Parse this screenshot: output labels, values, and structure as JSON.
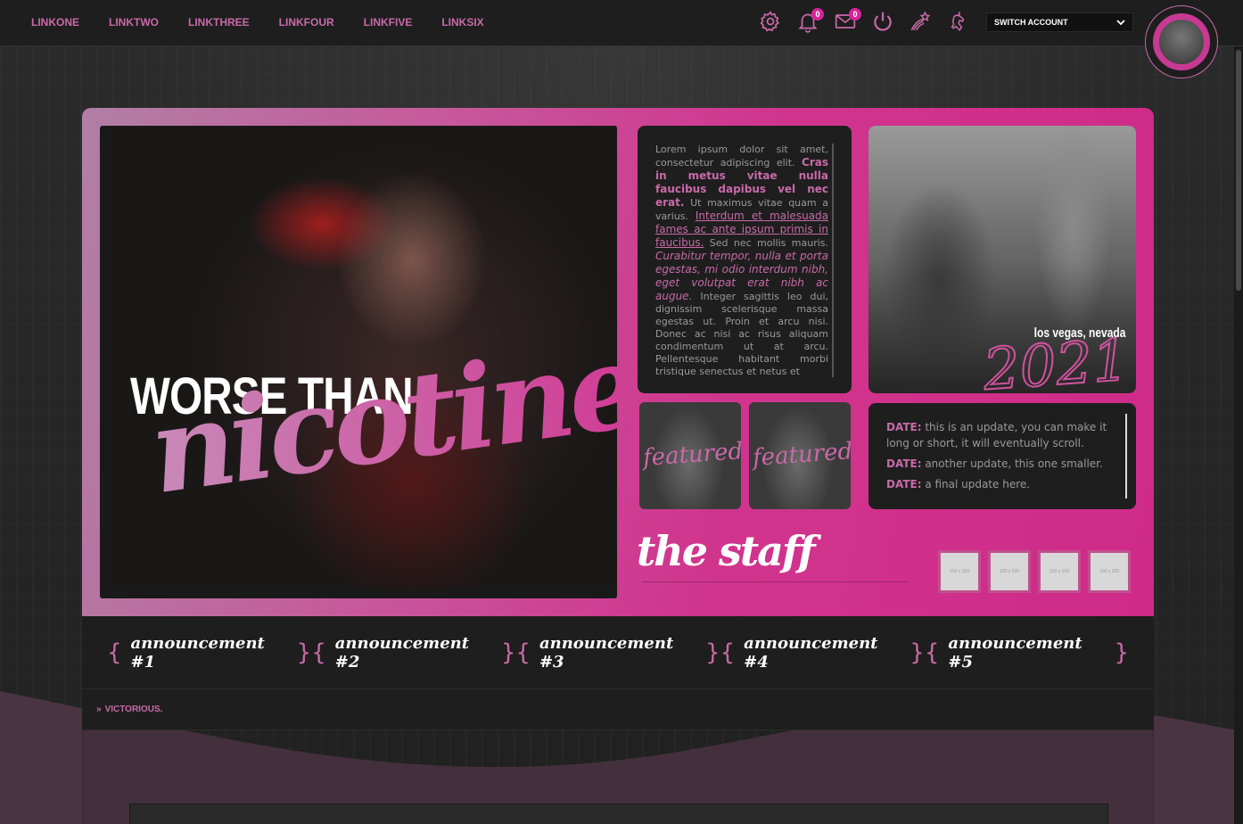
{
  "nav": {
    "links": [
      "LINKONE",
      "LINKTWO",
      "LINKTHREE",
      "LINKFOUR",
      "LINKFIVE",
      "LINKSIX"
    ],
    "notifications_count": "0",
    "messages_count": "0",
    "switch_account_label": "SWITCH ACCOUNT",
    "accent_color": "#c86aa8"
  },
  "hero": {
    "title": "WORSE THAN",
    "script": "nicotine"
  },
  "intro_text": {
    "p1": "Lorem ipsum dolor sit amet, consectetur adipiscing elit.",
    "bold": "Cras in metus vitae nulla faucibus dapibus vel nec erat.",
    "p2": "Ut maximus vitae quam a varius.",
    "link": "Interdum et malesuada fames ac ante ipsum primis in faucibus.",
    "p3": "Sed nec mollis mauris.",
    "italic": "Curabitur tempor, nulla et porta egestas, mi odio interdum nibh, eget volutpat erat nibh ac augue.",
    "p4": "Integer sagittis leo dui, dignissim scelerisque massa egestas ut. Proin et arcu nisi. Donec ac nisi ac risus aliquam condimentum ut at arcu. Pellentesque habitant morbi tristique senectus et netus et"
  },
  "location": {
    "caption": "los vegas, nevada",
    "year": "2021"
  },
  "featured": [
    "featured",
    "featured"
  ],
  "updates": [
    {
      "label": "DATE:",
      "text": "this is an update, you can make it long or short, it will eventually scroll."
    },
    {
      "label": "DATE:",
      "text": "another update, this one smaller."
    },
    {
      "label": "DATE:",
      "text": "a final update here."
    }
  ],
  "staff": {
    "title": "the staff",
    "slots": [
      "100 x 100",
      "100 x 100",
      "100 x 100",
      "100 x 100"
    ]
  },
  "announcements": [
    "announcement #1",
    "announcement #2",
    "announcement #3",
    "announcement #4",
    "announcement #5"
  ],
  "breadcrumb": {
    "arrow": "»",
    "current": "VICTORIOUS."
  }
}
